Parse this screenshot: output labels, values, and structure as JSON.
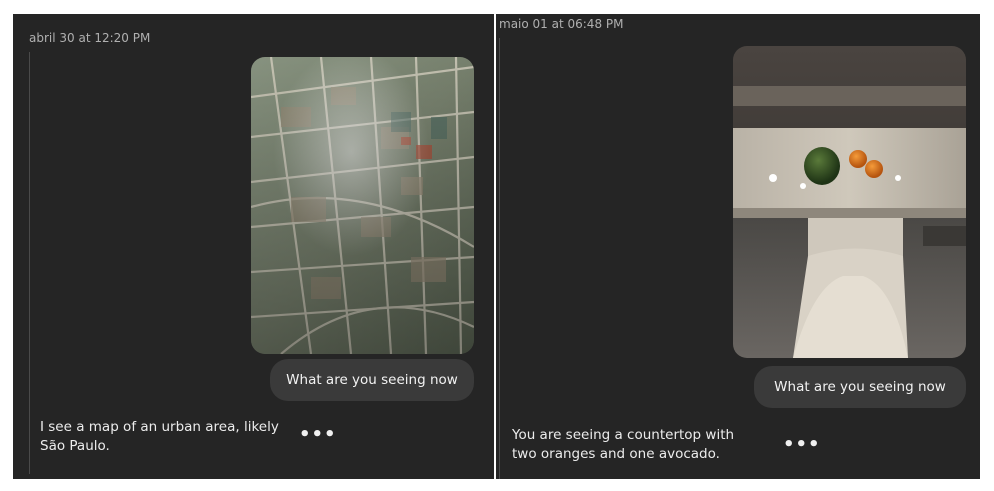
{
  "conversations": [
    {
      "timestamp": "abril 30 at 12:20 PM",
      "photo_subject": "map-photo",
      "user_message": "What are you seeing now",
      "ai_reply": {
        "line1": "I see a map of an urban area, likely",
        "line2": "São Paulo."
      },
      "more_icon": "more-options-icon"
    },
    {
      "timestamp": "maio 01 at 06:48 PM",
      "photo_subject": "countertop-photo",
      "user_message": "What are you seeing now",
      "ai_reply": {
        "line1": "You are seeing a countertop with",
        "line2": "two oranges and one avocado."
      },
      "more_icon": "more-options-icon"
    }
  ],
  "colors": {
    "panel_background": "#252525",
    "bubble_background": "#3a3a3a",
    "timestamp_text": "#b0b0b0",
    "body_text": "#ececec"
  }
}
